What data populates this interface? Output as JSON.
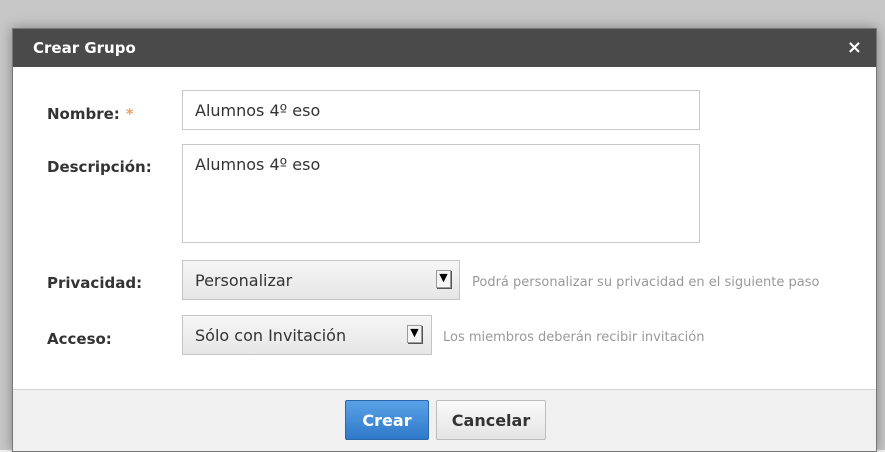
{
  "dialog": {
    "title": "Crear Grupo",
    "close_glyph": "×",
    "fields": {
      "name_label": "Nombre:",
      "required_marker": "*",
      "name_value": "Alumnos 4º eso",
      "description_label": "Descripción:",
      "description_value": "Alumnos 4º eso",
      "privacy_label": "Privacidad:",
      "privacy_value": "Personalizar",
      "privacy_help": "Podrá personalizar su privacidad en el siguiente paso",
      "access_label": "Acceso:",
      "access_value": "Sólo con Invitación",
      "access_help": "Los miembros deberán recibir invitación"
    },
    "buttons": {
      "create": "Crear",
      "cancel": "Cancelar"
    }
  },
  "icons": {
    "close": "close-icon",
    "dropdown": "chevron-down-icon"
  },
  "colors": {
    "titlebar": "#4a4a4a",
    "primary_button": "#3b86d6",
    "required": "#f0a060",
    "help_text": "#999999"
  }
}
